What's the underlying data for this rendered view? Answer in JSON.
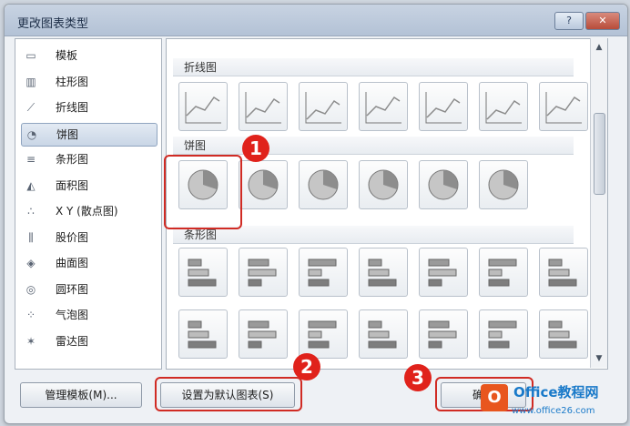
{
  "dialog": {
    "title": "更改图表类型",
    "help_label": "?",
    "close_label": "✕"
  },
  "categories": [
    {
      "label": "模板",
      "icon": "folder-icon",
      "glyph": "▭"
    },
    {
      "label": "柱形图",
      "icon": "column-chart-icon",
      "glyph": "▥"
    },
    {
      "label": "折线图",
      "icon": "line-chart-icon",
      "glyph": "⟋"
    },
    {
      "label": "饼图",
      "icon": "pie-chart-icon",
      "glyph": "◔",
      "selected": true
    },
    {
      "label": "条形图",
      "icon": "bar-chart-icon",
      "glyph": "≡"
    },
    {
      "label": "面积图",
      "icon": "area-chart-icon",
      "glyph": "◭"
    },
    {
      "label": "X Y (散点图)",
      "icon": "scatter-chart-icon",
      "glyph": "∴"
    },
    {
      "label": "股价图",
      "icon": "stock-chart-icon",
      "glyph": "⫼"
    },
    {
      "label": "曲面图",
      "icon": "surface-chart-icon",
      "glyph": "◈"
    },
    {
      "label": "圆环图",
      "icon": "doughnut-chart-icon",
      "glyph": "◎"
    },
    {
      "label": "气泡图",
      "icon": "bubble-chart-icon",
      "glyph": "⁘"
    },
    {
      "label": "雷达图",
      "icon": "radar-chart-icon",
      "glyph": "✶"
    }
  ],
  "sections": {
    "line": "折线图",
    "pie": "饼图",
    "bar": "条形图"
  },
  "buttons": {
    "manage_templates": "管理模板(M)...",
    "set_default": "设置为默认图表(S)",
    "ok": "确定"
  },
  "badges": [
    "1",
    "2",
    "3"
  ],
  "watermark": {
    "logo": "O",
    "brand": "Office教程网",
    "url": "www.office26.com"
  }
}
